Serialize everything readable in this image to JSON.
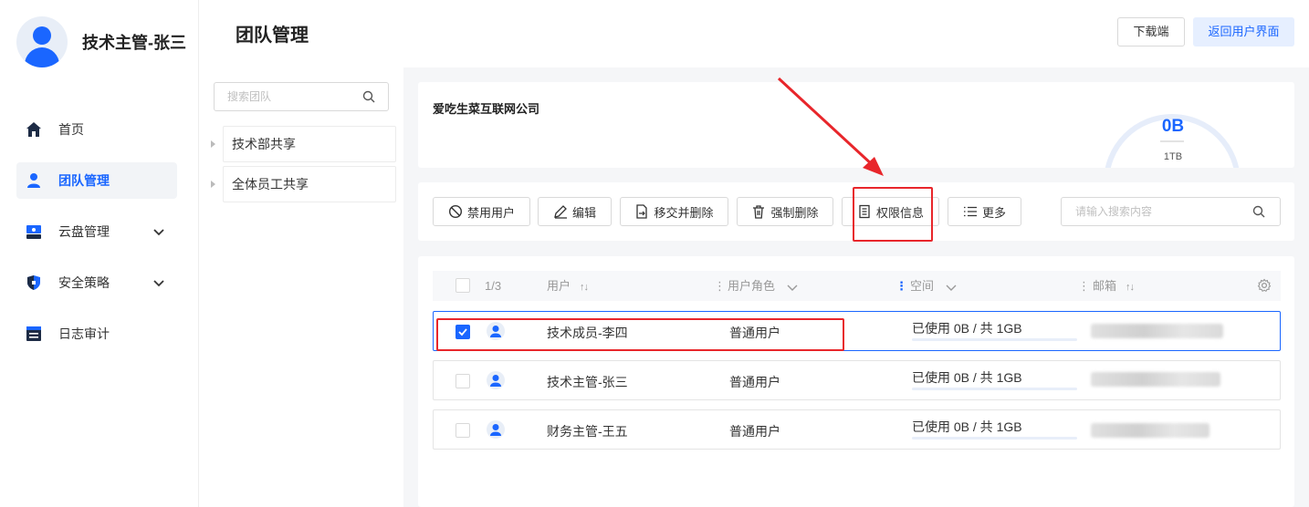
{
  "user": {
    "name": "技术主管-张三"
  },
  "nav": [
    {
      "label": "首页",
      "icon": "home-icon"
    },
    {
      "label": "团队管理",
      "icon": "team-icon",
      "active": true
    },
    {
      "label": "云盘管理",
      "icon": "cloud-drive-icon",
      "expandable": true
    },
    {
      "label": "安全策略",
      "icon": "shield-icon",
      "expandable": true
    },
    {
      "label": "日志审计",
      "icon": "log-icon"
    }
  ],
  "header": {
    "title": "团队管理",
    "download_label": "下载端",
    "return_label": "返回用户界面"
  },
  "team_panel": {
    "search_placeholder": "搜索团队",
    "items": [
      "技术部共享",
      "全体员工共享"
    ]
  },
  "company": {
    "name": "爱吃生菜互联网公司",
    "used": "0B",
    "total": "1TB"
  },
  "toolbar": {
    "disable_user": "禁用用户",
    "edit": "编辑",
    "transfer_delete": "移交并删除",
    "force_delete": "强制删除",
    "permission_info": "权限信息",
    "more": "更多",
    "search_placeholder": "请输入搜索内容"
  },
  "table": {
    "selection_count": "1/3",
    "columns": {
      "user": "用户",
      "role": "用户角色",
      "space": "空间",
      "email": "邮箱"
    },
    "rows": [
      {
        "name": "技术成员-李四",
        "role": "普通用户",
        "usage": "已使用 0B / 共 1GB",
        "checked": true
      },
      {
        "name": "技术主管-张三",
        "role": "普通用户",
        "usage": "已使用 0B / 共 1GB",
        "checked": false
      },
      {
        "name": "财务主管-王五",
        "role": "普通用户",
        "usage": "已使用 0B / 共 1GB",
        "checked": false
      }
    ]
  },
  "colors": {
    "accent": "#1a66ff",
    "annotation": "#e8262b"
  }
}
